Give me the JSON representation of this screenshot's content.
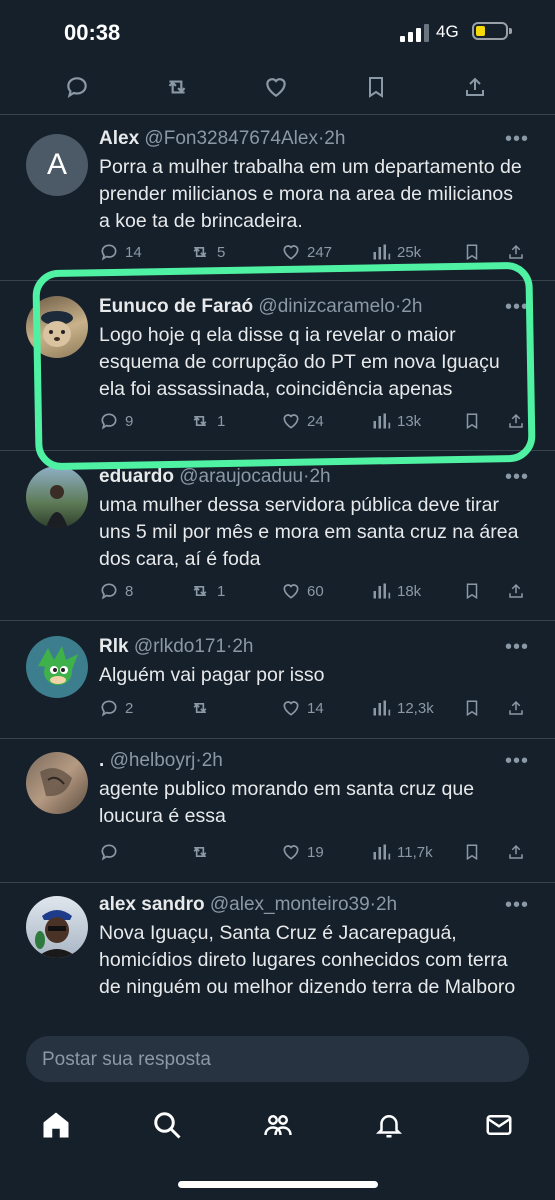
{
  "status": {
    "time": "00:38",
    "network": "4G",
    "battery_color": "#f5d90a"
  },
  "action_bar": [
    "reply-icon",
    "retweet-icon",
    "like-icon",
    "bookmark-icon",
    "share-icon"
  ],
  "tweets": [
    {
      "avatar_letter": "A",
      "name": "Alex",
      "handle": "@Fon32847674Alex",
      "time": "2h",
      "text": "Porra a mulher trabalha em um departamento de prender milicianos e mora na area de milicianos a koe ta de brincadeira.",
      "replies": "14",
      "retweets": "5",
      "likes": "247",
      "views": "25k"
    },
    {
      "name": "Eunuco de Faraó",
      "handle": "@dinizcaramelo",
      "time": "2h",
      "text": "Logo hoje q ela disse q ia revelar o maior esquema de corrupção do PT em nova Iguaçu ela foi assassinada, coincidência apenas",
      "replies": "9",
      "retweets": "1",
      "likes": "24",
      "views": "13k"
    },
    {
      "name": "eduardo",
      "handle": "@araujocaduu",
      "time": "2h",
      "text": "uma mulher dessa servidora pública deve tirar uns 5 mil por mês e mora em santa cruz na área dos cara, aí é foda",
      "replies": "8",
      "retweets": "1",
      "likes": "60",
      "views": "18k"
    },
    {
      "name": "Rlk",
      "handle": "@rlkdo171",
      "time": "2h",
      "text": "Alguém vai pagar por isso",
      "replies": "2",
      "retweets": "",
      "likes": "14",
      "views": "12,3k"
    },
    {
      "name": ".",
      "handle": "@helboyrj",
      "time": "2h",
      "text": "agente publico morando em santa cruz que loucura é essa",
      "replies": "",
      "retweets": "",
      "likes": "19",
      "views": "11,7k"
    },
    {
      "name": "alex sandro",
      "handle": "@alex_monteiro39",
      "time": "2h",
      "text": "Nova Iguaçu, Santa Cruz é Jacarepaguá, homicídios direto lugares conhecidos com terra de ninguém ou melhor dizendo terra de Malboro"
    }
  ],
  "reply_placeholder": "Postar sua resposta",
  "highlight_color": "#4ff2a2",
  "bottom_nav": [
    "home-icon",
    "search-icon",
    "communities-icon",
    "notifications-icon",
    "messages-icon"
  ]
}
